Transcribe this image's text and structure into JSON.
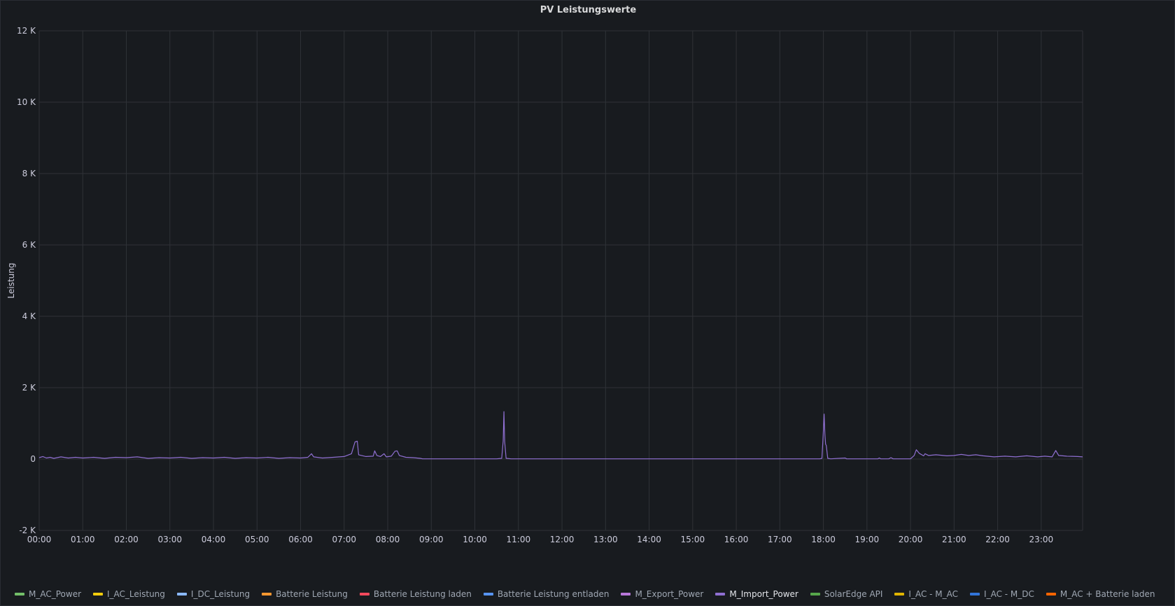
{
  "panel": {
    "title": "PV Leistungswerte"
  },
  "legend": [
    {
      "label": "M_AC_Power",
      "color": "#73bf69"
    },
    {
      "label": "I_AC_Leistung",
      "color": "#f2cc0c"
    },
    {
      "label": "I_DC_Leistung",
      "color": "#8ab8ff"
    },
    {
      "label": "Batterie Leistung",
      "color": "#ff9830"
    },
    {
      "label": "Batterie Leistung laden",
      "color": "#f2495c"
    },
    {
      "label": "Batterie Leistung entladen",
      "color": "#5794f2"
    },
    {
      "label": "M_Export_Power",
      "color": "#b877d9"
    },
    {
      "label": "M_Import_Power",
      "color": "#8f6fd1",
      "active": true
    },
    {
      "label": "SolarEdge API",
      "color": "#56a64b"
    },
    {
      "label": "I_AC - M_AC",
      "color": "#e0b400"
    },
    {
      "label": "I_AC - M_DC",
      "color": "#3274d9"
    },
    {
      "label": "M_AC + Batterie laden",
      "color": "#fa6400"
    }
  ],
  "chart_data": {
    "type": "line",
    "title": "PV Leistungswerte",
    "xlabel": "",
    "ylabel": "Leistung",
    "ylim": [
      -2000,
      12000
    ],
    "yticks": [
      -2000,
      0,
      2000,
      4000,
      6000,
      8000,
      10000,
      12000
    ],
    "ytick_labels": [
      "-2 K",
      "0",
      "2 K",
      "4 K",
      "6 K",
      "8 K",
      "10 K",
      "12 K"
    ],
    "xlim": [
      "00:00",
      "23:57"
    ],
    "xtick_labels": [
      "00:00",
      "01:00",
      "02:00",
      "03:00",
      "04:00",
      "05:00",
      "06:00",
      "07:00",
      "08:00",
      "09:00",
      "10:00",
      "11:00",
      "12:00",
      "13:00",
      "14:00",
      "15:00",
      "16:00",
      "17:00",
      "18:00",
      "19:00",
      "20:00",
      "21:00",
      "22:00",
      "23:00"
    ],
    "grid": true,
    "legend_position": "bottom",
    "series": [
      {
        "name": "M_Import_Power",
        "color": "#8f6fd1",
        "points": [
          [
            "00:00",
            40
          ],
          [
            "00:05",
            70
          ],
          [
            "00:10",
            30
          ],
          [
            "00:15",
            50
          ],
          [
            "00:20",
            20
          ],
          [
            "00:30",
            60
          ],
          [
            "00:40",
            30
          ],
          [
            "00:50",
            50
          ],
          [
            "01:00",
            30
          ],
          [
            "01:15",
            50
          ],
          [
            "01:30",
            20
          ],
          [
            "01:45",
            50
          ],
          [
            "02:00",
            40
          ],
          [
            "02:15",
            60
          ],
          [
            "02:30",
            20
          ],
          [
            "02:45",
            40
          ],
          [
            "03:00",
            30
          ],
          [
            "03:15",
            50
          ],
          [
            "03:30",
            20
          ],
          [
            "03:45",
            40
          ],
          [
            "04:00",
            30
          ],
          [
            "04:15",
            50
          ],
          [
            "04:30",
            20
          ],
          [
            "04:45",
            40
          ],
          [
            "05:00",
            30
          ],
          [
            "05:15",
            50
          ],
          [
            "05:30",
            20
          ],
          [
            "05:45",
            40
          ],
          [
            "06:00",
            30
          ],
          [
            "06:10",
            50
          ],
          [
            "06:15",
            150
          ],
          [
            "06:18",
            60
          ],
          [
            "06:30",
            30
          ],
          [
            "06:45",
            50
          ],
          [
            "07:00",
            70
          ],
          [
            "07:10",
            150
          ],
          [
            "07:15",
            480
          ],
          [
            "07:18",
            500
          ],
          [
            "07:20",
            120
          ],
          [
            "07:30",
            70
          ],
          [
            "07:40",
            80
          ],
          [
            "07:42",
            230
          ],
          [
            "07:45",
            100
          ],
          [
            "07:50",
            70
          ],
          [
            "07:55",
            150
          ],
          [
            "07:58",
            60
          ],
          [
            "08:05",
            80
          ],
          [
            "08:10",
            220
          ],
          [
            "08:13",
            230
          ],
          [
            "08:16",
            100
          ],
          [
            "08:25",
            50
          ],
          [
            "08:35",
            40
          ],
          [
            "08:45",
            20
          ],
          [
            "08:48",
            5
          ],
          [
            "09:00",
            5
          ],
          [
            "10:30",
            5
          ],
          [
            "10:37",
            20
          ],
          [
            "10:39",
            500
          ],
          [
            "10:40",
            1330
          ],
          [
            "10:41",
            500
          ],
          [
            "10:43",
            20
          ],
          [
            "10:50",
            5
          ],
          [
            "12:00",
            5
          ],
          [
            "14:00",
            5
          ],
          [
            "16:00",
            5
          ],
          [
            "17:55",
            5
          ],
          [
            "17:58",
            20
          ],
          [
            "18:00",
            800
          ],
          [
            "18:01",
            1260
          ],
          [
            "18:02",
            700
          ],
          [
            "18:03",
            420
          ],
          [
            "18:04",
            380
          ],
          [
            "18:06",
            20
          ],
          [
            "18:10",
            5
          ],
          [
            "18:30",
            30
          ],
          [
            "18:32",
            5
          ],
          [
            "19:15",
            5
          ],
          [
            "19:17",
            30
          ],
          [
            "19:19",
            5
          ],
          [
            "19:30",
            5
          ],
          [
            "19:33",
            40
          ],
          [
            "19:36",
            5
          ],
          [
            "20:00",
            5
          ],
          [
            "20:05",
            100
          ],
          [
            "20:08",
            260
          ],
          [
            "20:12",
            160
          ],
          [
            "20:18",
            90
          ],
          [
            "20:20",
            150
          ],
          [
            "20:25",
            100
          ],
          [
            "20:35",
            120
          ],
          [
            "20:50",
            90
          ],
          [
            "21:00",
            100
          ],
          [
            "21:10",
            130
          ],
          [
            "21:20",
            100
          ],
          [
            "21:30",
            120
          ],
          [
            "21:40",
            90
          ],
          [
            "21:55",
            60
          ],
          [
            "22:10",
            80
          ],
          [
            "22:25",
            60
          ],
          [
            "22:40",
            90
          ],
          [
            "22:55",
            60
          ],
          [
            "23:05",
            80
          ],
          [
            "23:15",
            60
          ],
          [
            "23:20",
            240
          ],
          [
            "23:24",
            100
          ],
          [
            "23:35",
            80
          ],
          [
            "23:50",
            70
          ],
          [
            "23:57",
            60
          ]
        ]
      }
    ]
  }
}
